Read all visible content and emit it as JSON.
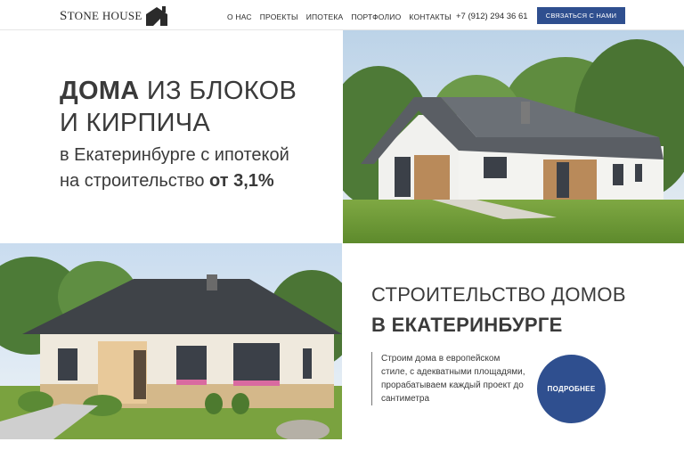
{
  "header": {
    "logo_text_1": "S",
    "logo_text_2": "TONE HOUSE",
    "nav": [
      "О НАС",
      "ПРОЕКТЫ",
      "ИПОТЕКА",
      "ПОРТФОЛИО",
      "КОНТАКТЫ"
    ],
    "phone": "+7 (912) 294 36 61",
    "cta_label": "СВЯЗАТЬСЯ С НАМИ"
  },
  "hero": {
    "title_bold": "ДОМА",
    "title_rest": " ИЗ БЛОКОВ",
    "title_line2": "И КИРПИЧА",
    "sub_line1": "в Екатеринбурге с ипотекой",
    "sub_line2": "на строительство ",
    "sub_bold": "от 3,1%"
  },
  "section": {
    "title_line1": "СТРОИТЕЛЬСТВО ДОМОВ",
    "title_line2": "В ЕКАТЕРИНБУРГЕ",
    "description": "Строим дома в европейском стиле, с адекватными площадями, прорабатываем каждый проект до сантиметра",
    "more_label": "ПОДРОБНЕЕ"
  },
  "colors": {
    "accent": "#2f4f8f",
    "text": "#3a3a3a"
  }
}
